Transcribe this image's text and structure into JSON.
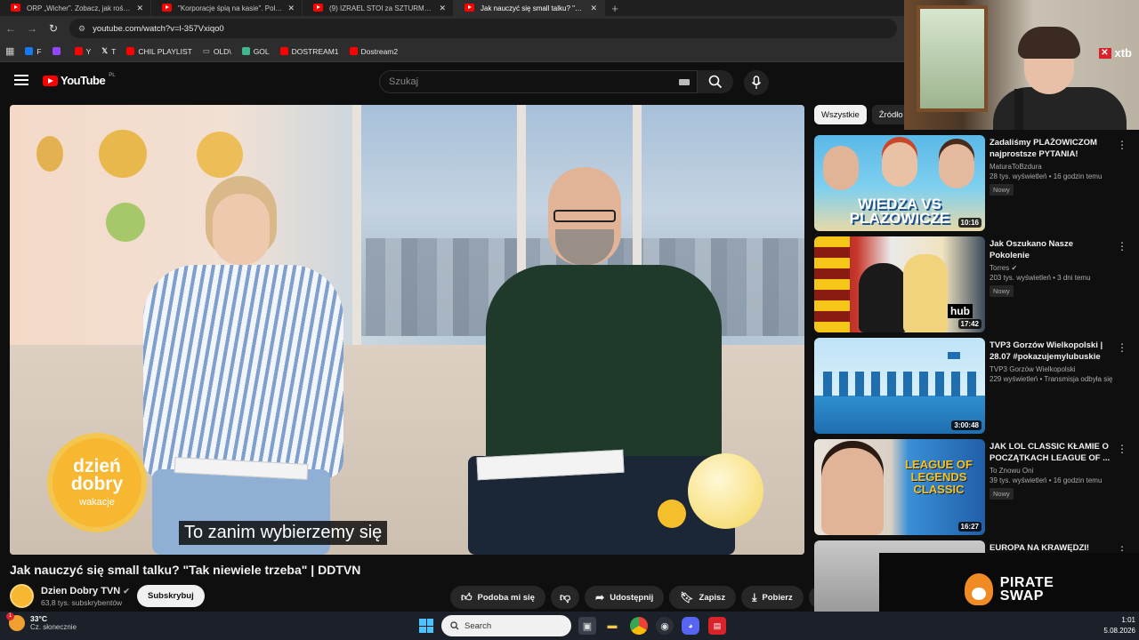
{
  "browser": {
    "tabs": [
      {
        "title": "ORP „Wicher”. Zobacz, jak rośnie",
        "active": false
      },
      {
        "title": "\"Korporacje śpią na kasie\". Polska",
        "active": false
      },
      {
        "title": "(9) IZRAEL STOI za SZTURMEM",
        "active": false
      },
      {
        "title": "Jak nauczyć się small talku? \"Tak",
        "active": true
      }
    ],
    "url": "youtube.com/watch?v=l-357Vxiqo0",
    "bookmarks": [
      {
        "label": "F",
        "color": "#1877f2"
      },
      {
        "label": "",
        "color": "#9146ff"
      },
      {
        "label": "Y",
        "color": "#ff0000"
      },
      {
        "label": "T",
        "color": "#ffffff"
      },
      {
        "label": "CHIL PLAYLIST",
        "color": "#ff0000"
      },
      {
        "label": "OLD\\",
        "color": "#bbbbbb"
      },
      {
        "label": "GOL",
        "color": "#3fb68b"
      },
      {
        "label": "DOSTREAM1",
        "color": "#ff0000"
      },
      {
        "label": "Dostream2",
        "color": "#ff0000"
      }
    ]
  },
  "youtube": {
    "logo_text": "YouTube",
    "region": "PL",
    "search_placeholder": "Szukaj"
  },
  "video": {
    "subtitle": "To zanim wybierzemy się",
    "logo_line1": "dzień",
    "logo_line2": "dobry",
    "logo_line3": "wakacje",
    "title": "Jak nauczyć się small talku? \"Tak niewiele trzeba\" | DDTVN",
    "channel": "Dzien Dobry TVN",
    "subscribers": "63,8 tys. subskrybentów",
    "subscribe_label": "Subskrybuj",
    "actions": {
      "like": "Podoba mi się",
      "share": "Udostępnij",
      "save": "Zapisz",
      "download": "Pobierz"
    }
  },
  "sidebar": {
    "chips": [
      "Wszystkie",
      "Źródło"
    ],
    "recommendations": [
      {
        "title": "Zadaliśmy PLAŻOWICZOM najprostsze PYTANIA!",
        "channel": "MaturaToBzdura",
        "stats": "28 tys. wyświetleń • 16 godzin temu",
        "badge": "Nowy",
        "duration": "10:16",
        "thumb_text": "WIEDZA VS PLAZOWICZE"
      },
      {
        "title": "Jak Oszukano Nasze Pokolenie",
        "channel": "Torres",
        "stats": "203 tys. wyświetleń • 3 dni temu",
        "badge": "Nowy",
        "duration": "17:42",
        "thumb_text": "hub"
      },
      {
        "title": "TVP3 Gorzów Wielkopolski | 28.07 #pokazujemylubuskie",
        "channel": "TVP3 Gorzów Wielkopolski",
        "stats": "229 wyświetleń • Transmisja odbyła się ...",
        "badge": "",
        "duration": "3:00:48",
        "thumb_text": ""
      },
      {
        "title": "JAK LOL CLASSIC KŁAMIE O POCZĄTKACH LEAGUE OF ...",
        "channel": "To Znowu Oni",
        "stats": "39 tys. wyświetleń • 16 godzin temu",
        "badge": "Nowy",
        "duration": "16:27",
        "thumb_text": "LEAGUE OF LEGENDS CLASSIC"
      },
      {
        "title": "EUROPA NA KRAWĘDZI!",
        "channel": "",
        "stats": "",
        "badge": "",
        "duration": "",
        "thumb_text": ""
      }
    ]
  },
  "overlay": {
    "sponsor": "xtb",
    "pirate_line1": "PIRATE",
    "pirate_line2": "SWAP"
  },
  "taskbar": {
    "temperature": "33°C",
    "weather": "Cz. słonecznie",
    "weather_alerts": "1",
    "search": "Search",
    "time": "1:01",
    "date": "5.08.2026"
  }
}
